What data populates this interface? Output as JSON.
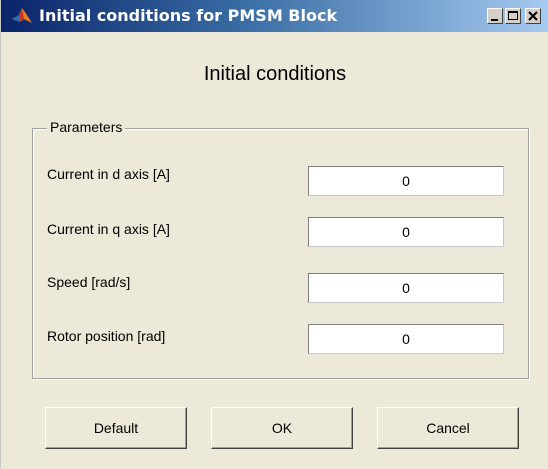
{
  "window": {
    "title": "Initial conditions for PMSM Block",
    "icon": "matlab-logo-icon",
    "controls": [
      "minimize-icon",
      "maximize-icon",
      "close-icon"
    ]
  },
  "heading": "Initial conditions",
  "parameters": {
    "group_label": "Parameters",
    "fields": [
      {
        "label": "Current in d axis  [A]",
        "value": "0"
      },
      {
        "label": "Current in q axis  [A]",
        "value": "0"
      },
      {
        "label": "Speed [rad/s]",
        "value": "0"
      },
      {
        "label": "Rotor position [rad]",
        "value": "0"
      }
    ]
  },
  "buttons": {
    "default_label": "Default",
    "ok_label": "OK",
    "cancel_label": "Cancel"
  },
  "colors": {
    "dialog_background": "#ece9d8",
    "titlebar_start": "#0a246a",
    "titlebar_end": "#a6caf0"
  }
}
